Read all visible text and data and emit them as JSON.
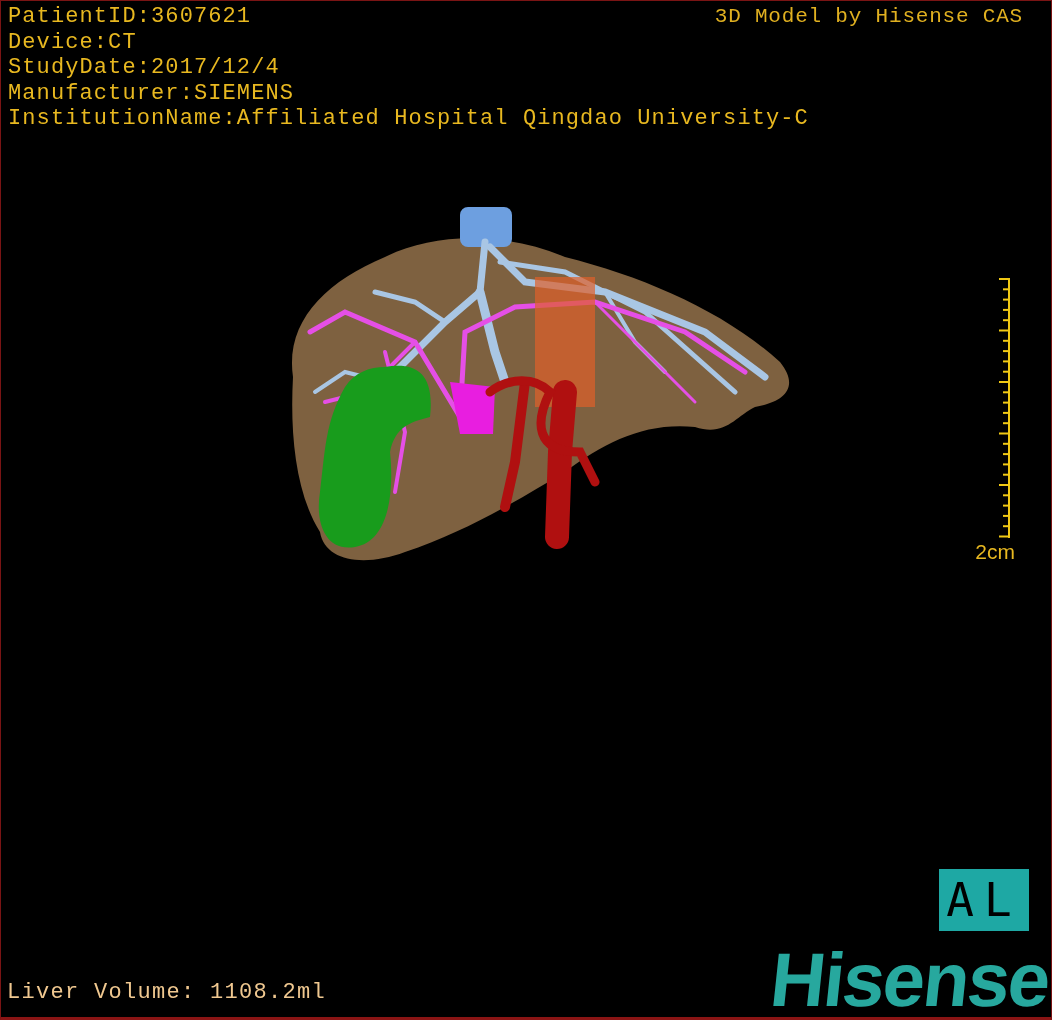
{
  "header": {
    "info_lines": [
      "PatientID:3607621",
      "Device:CT",
      "StudyDate:2017/12/4",
      "Manufacturer:SIEMENS",
      "InstitutionName:Affiliated Hospital Qingdao University-C"
    ],
    "credit": "3D Model by Hisense CAS"
  },
  "viewport": {
    "scale_label": "2cm",
    "orientation_label": "AL"
  },
  "footer": {
    "liver_volume": "Liver Volume: 1108.2ml",
    "logo": "Hisense"
  }
}
